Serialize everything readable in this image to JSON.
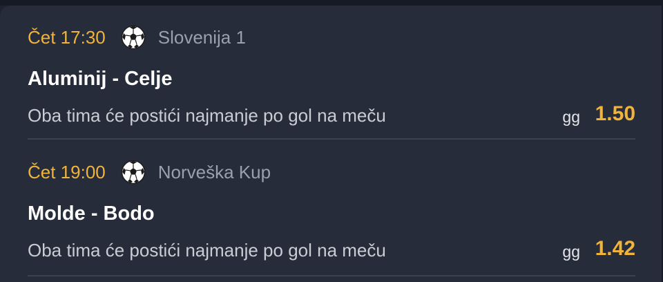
{
  "matches": [
    {
      "time": "Čet 17:30",
      "sport_icon": "soccer-ball-icon",
      "league": "Slovenija 1",
      "teams": "Aluminij - Celje",
      "pick": "Oba tima će postići najmanje po gol na meču",
      "code": "gg",
      "odd": "1.50"
    },
    {
      "time": "Čet 19:00",
      "sport_icon": "soccer-ball-icon",
      "league": "Norveška Kup",
      "teams": "Molde - Bodo",
      "pick": "Oba tima će postići najmanje po gol na meču",
      "code": "gg",
      "odd": "1.42"
    }
  ],
  "colors": {
    "background": "#1d2331",
    "card": "#262c3a",
    "accent": "#f0b43a",
    "muted": "#9aa0ac",
    "divider": "#3b4252"
  }
}
